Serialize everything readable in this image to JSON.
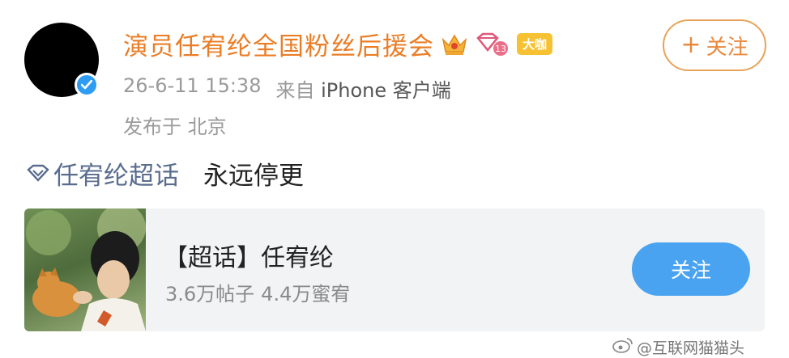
{
  "post": {
    "user_name": "演员任宥纶全国粉丝后援会",
    "badge_big_coffee": "大咖",
    "membership_level": "13",
    "timestamp": "26-6-11 15:38",
    "source_prefix": "来自",
    "source_device": "iPhone 客户端",
    "location": "发布于 北京",
    "follow_button": {
      "plus": "+",
      "label": "关注"
    },
    "topic_link": "任宥纶超话",
    "body": "永远停更"
  },
  "card": {
    "title": "【超话】任宥纶",
    "posts_count": "3.6万帖子",
    "fans_count": "4.4万蜜宥",
    "follow_label": "关注"
  },
  "watermark": {
    "text": "@互联网猫猫头"
  },
  "colors": {
    "accent_orange": "#ea7d26",
    "follow_border": "#e7a35a",
    "link_blue": "#5a6d8f",
    "card_button": "#4aa3f0",
    "verified_blue": "#2f9cf4",
    "gold_badge": "#f6c233"
  }
}
